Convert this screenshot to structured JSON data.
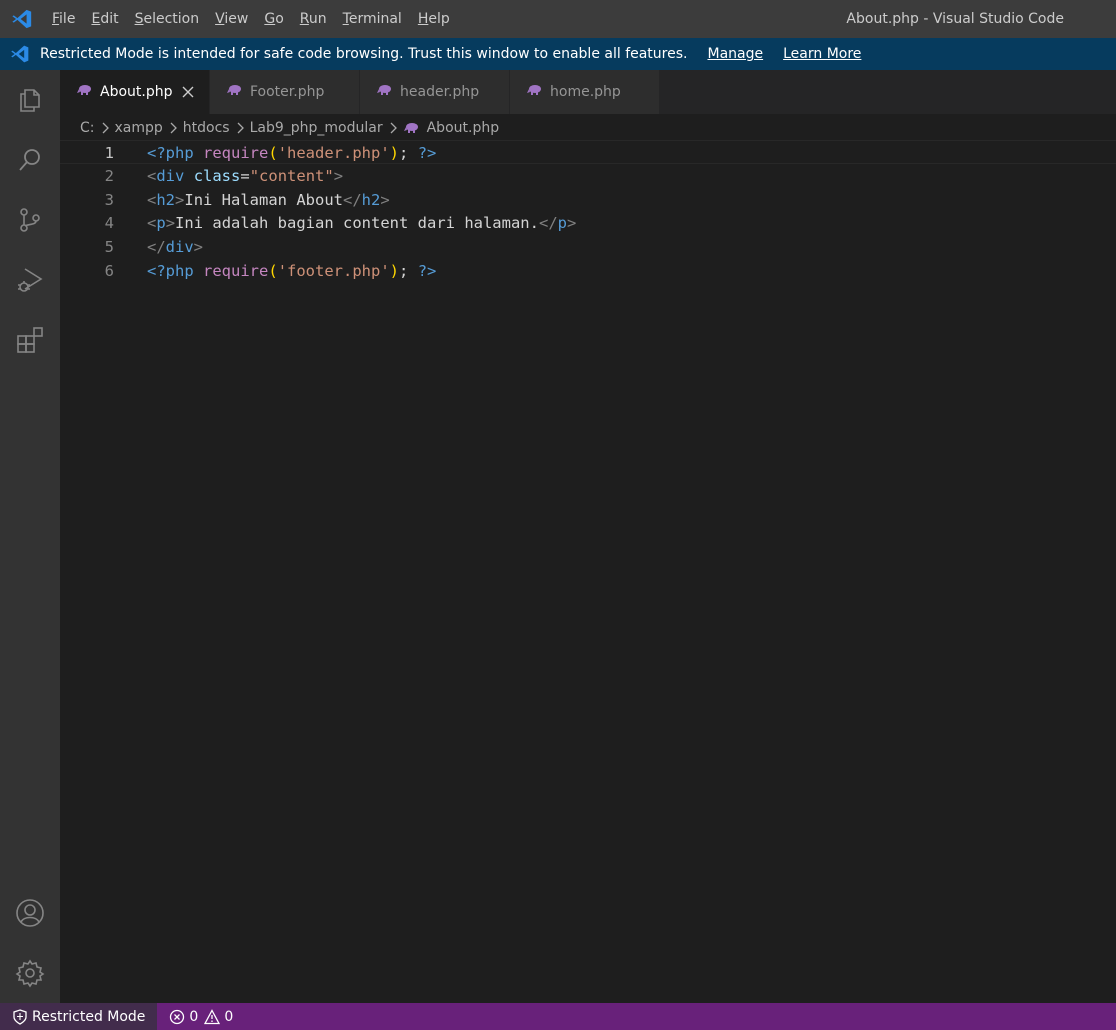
{
  "window": {
    "title": "About.php - Visual Studio Code",
    "menu": [
      {
        "mnemonic": "F",
        "rest": "ile"
      },
      {
        "mnemonic": "E",
        "rest": "dit"
      },
      {
        "mnemonic": "S",
        "rest": "election"
      },
      {
        "mnemonic": "V",
        "rest": "iew"
      },
      {
        "mnemonic": "G",
        "rest": "o"
      },
      {
        "mnemonic": "R",
        "rest": "un"
      },
      {
        "mnemonic": "T",
        "rest": "erminal"
      },
      {
        "mnemonic": "H",
        "rest": "elp"
      }
    ]
  },
  "banner": {
    "text": "Restricted Mode is intended for safe code browsing. Trust this window to enable all features.",
    "manage": "Manage",
    "learn_more": "Learn More"
  },
  "activity": [
    "explorer-icon",
    "search-icon",
    "source-control-icon",
    "run-debug-icon",
    "extensions-icon",
    "accounts-icon",
    "settings-gear-icon"
  ],
  "tabs": [
    {
      "label": "About.php",
      "active": true
    },
    {
      "label": "Footer.php",
      "active": false
    },
    {
      "label": "header.php",
      "active": false
    },
    {
      "label": "home.php",
      "active": false
    }
  ],
  "breadcrumb": [
    "C:",
    "xampp",
    "htdocs",
    "Lab9_php_modular",
    "About.php"
  ],
  "editor": {
    "current_line": 1,
    "line_numbers": [
      "1",
      "2",
      "3",
      "4",
      "5",
      "6"
    ],
    "lines": [
      [
        [
          "t-php",
          "<?php"
        ],
        [
          "t-txt",
          " "
        ],
        [
          "t-kw",
          "require"
        ],
        [
          "t-paren",
          "("
        ],
        [
          "t-str",
          "'header.php'"
        ],
        [
          "t-paren",
          ")"
        ],
        [
          "t-txt",
          "; "
        ],
        [
          "t-php",
          "?>"
        ]
      ],
      [
        [
          "t-tag",
          "<"
        ],
        [
          "t-el",
          "div"
        ],
        [
          "t-txt",
          " "
        ],
        [
          "t-attr",
          "class"
        ],
        [
          "t-txt",
          "="
        ],
        [
          "t-str",
          "\"content\""
        ],
        [
          "t-tag",
          ">"
        ]
      ],
      [
        [
          "t-tag",
          "<"
        ],
        [
          "t-el",
          "h2"
        ],
        [
          "t-tag",
          ">"
        ],
        [
          "t-txt",
          "Ini Halaman About"
        ],
        [
          "t-tag",
          "</"
        ],
        [
          "t-el",
          "h2"
        ],
        [
          "t-tag",
          ">"
        ]
      ],
      [
        [
          "t-tag",
          "<"
        ],
        [
          "t-el",
          "p"
        ],
        [
          "t-tag",
          ">"
        ],
        [
          "t-txt",
          "Ini adalah bagian content dari halaman."
        ],
        [
          "t-tag",
          "</"
        ],
        [
          "t-el",
          "p"
        ],
        [
          "t-tag",
          ">"
        ]
      ],
      [
        [
          "t-tag",
          "</"
        ],
        [
          "t-el",
          "div"
        ],
        [
          "t-tag",
          ">"
        ]
      ],
      [
        [
          "t-php",
          "<?php"
        ],
        [
          "t-txt",
          " "
        ],
        [
          "t-kw",
          "require"
        ],
        [
          "t-paren",
          "("
        ],
        [
          "t-str",
          "'footer.php'"
        ],
        [
          "t-paren",
          ")"
        ],
        [
          "t-txt",
          "; "
        ],
        [
          "t-php",
          "?>"
        ]
      ]
    ]
  },
  "status": {
    "restricted": "Restricted Mode",
    "errors": "0",
    "warnings": "0"
  },
  "colors": {
    "banner_bg": "#063b5e",
    "status_bg": "#68217a",
    "php_icon": "#a074c4",
    "vscode_blue": "#2b8ae6"
  }
}
